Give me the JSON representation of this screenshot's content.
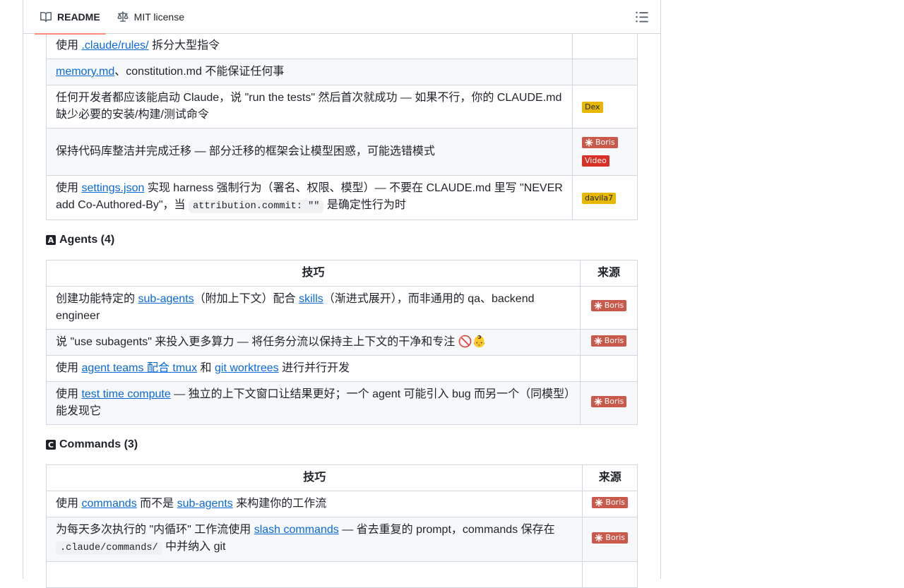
{
  "tabs": {
    "readme": "README",
    "license": "MIT license"
  },
  "table1": {
    "rows": [
      {
        "pre": "使用 ",
        "link": ".claude/rules/",
        "post": " 拆分大型指令"
      },
      {
        "link": "memory.md",
        "post": "、constitution.md 不能保证任何事"
      },
      {
        "text": "任何开发者都应该能启动 Claude，说 \"run the tests\" 然后首次就成功 — 如果不行，你的 CLAUDE.md 缺少必要的安装/构建/测试命令",
        "badge": "Dex"
      },
      {
        "text": "保持代码库整洁并完成迁移 — 部分迁移的框架会让模型困惑，可能选错模式",
        "badge1": "Boris",
        "badge2": "Video"
      },
      {
        "pre": "使用 ",
        "link": "settings.json",
        "post": " 实现 harness 强制行为（署名、权限、模型）— 不要在 CLAUDE.md 里写 \"NEVER add Co-Authored-By\"，当 ",
        "code": "attribution.commit: \"\"",
        "post2": " 是确定性行为时",
        "badge": "davila7"
      }
    ]
  },
  "agents": {
    "heading": "Agents (4)",
    "icon_letter": "A",
    "col_tip": "技巧",
    "col_src": "来源",
    "rows": [
      {
        "pre": "创建功能特定的 ",
        "link1": "sub-agents",
        "mid": "（附加上下文）配合 ",
        "link2": "skills",
        "post": "（渐进式展开），而非通用的 qa、backend engineer",
        "badge": "Boris"
      },
      {
        "text": "说 \"use subagents\" 来投入更多算力 — 将任务分流以保持主上下文的干净和专注 🚫👶",
        "badge": "Boris"
      },
      {
        "pre": "使用 ",
        "link1": "agent teams 配合 tmux",
        "mid": " 和 ",
        "link2": "git worktrees",
        "post": " 进行并行开发"
      },
      {
        "pre": "使用 ",
        "link1": "test time compute",
        "post": " — 独立的上下文窗口让结果更好；一个 agent 可能引入 bug 而另一个（同模型）能发现它",
        "badge": "Boris"
      }
    ]
  },
  "commands": {
    "heading": "Commands (3)",
    "icon_letter": "C",
    "col_tip": "技巧",
    "col_src": "来源",
    "rows": [
      {
        "pre": "使用 ",
        "link1": "commands",
        "mid": " 而不是 ",
        "link2": "sub-agents",
        "post": " 来构建你的工作流",
        "badge": "Boris"
      },
      {
        "pre": "为每天多次执行的 \"内循环\" 工作流使用 ",
        "link1": "slash commands",
        "mid": " — 省去重复的 prompt，commands 保存在 ",
        "code": ".claude/commands/",
        "post": " 中并纳入 git",
        "badge": "Boris"
      }
    ]
  },
  "colors": {
    "link": "#0969da",
    "border": "#d0d7de",
    "tab_active": "#fd8c73",
    "badge_boris": "#c9594a",
    "badge_dex": "#e8b700"
  }
}
